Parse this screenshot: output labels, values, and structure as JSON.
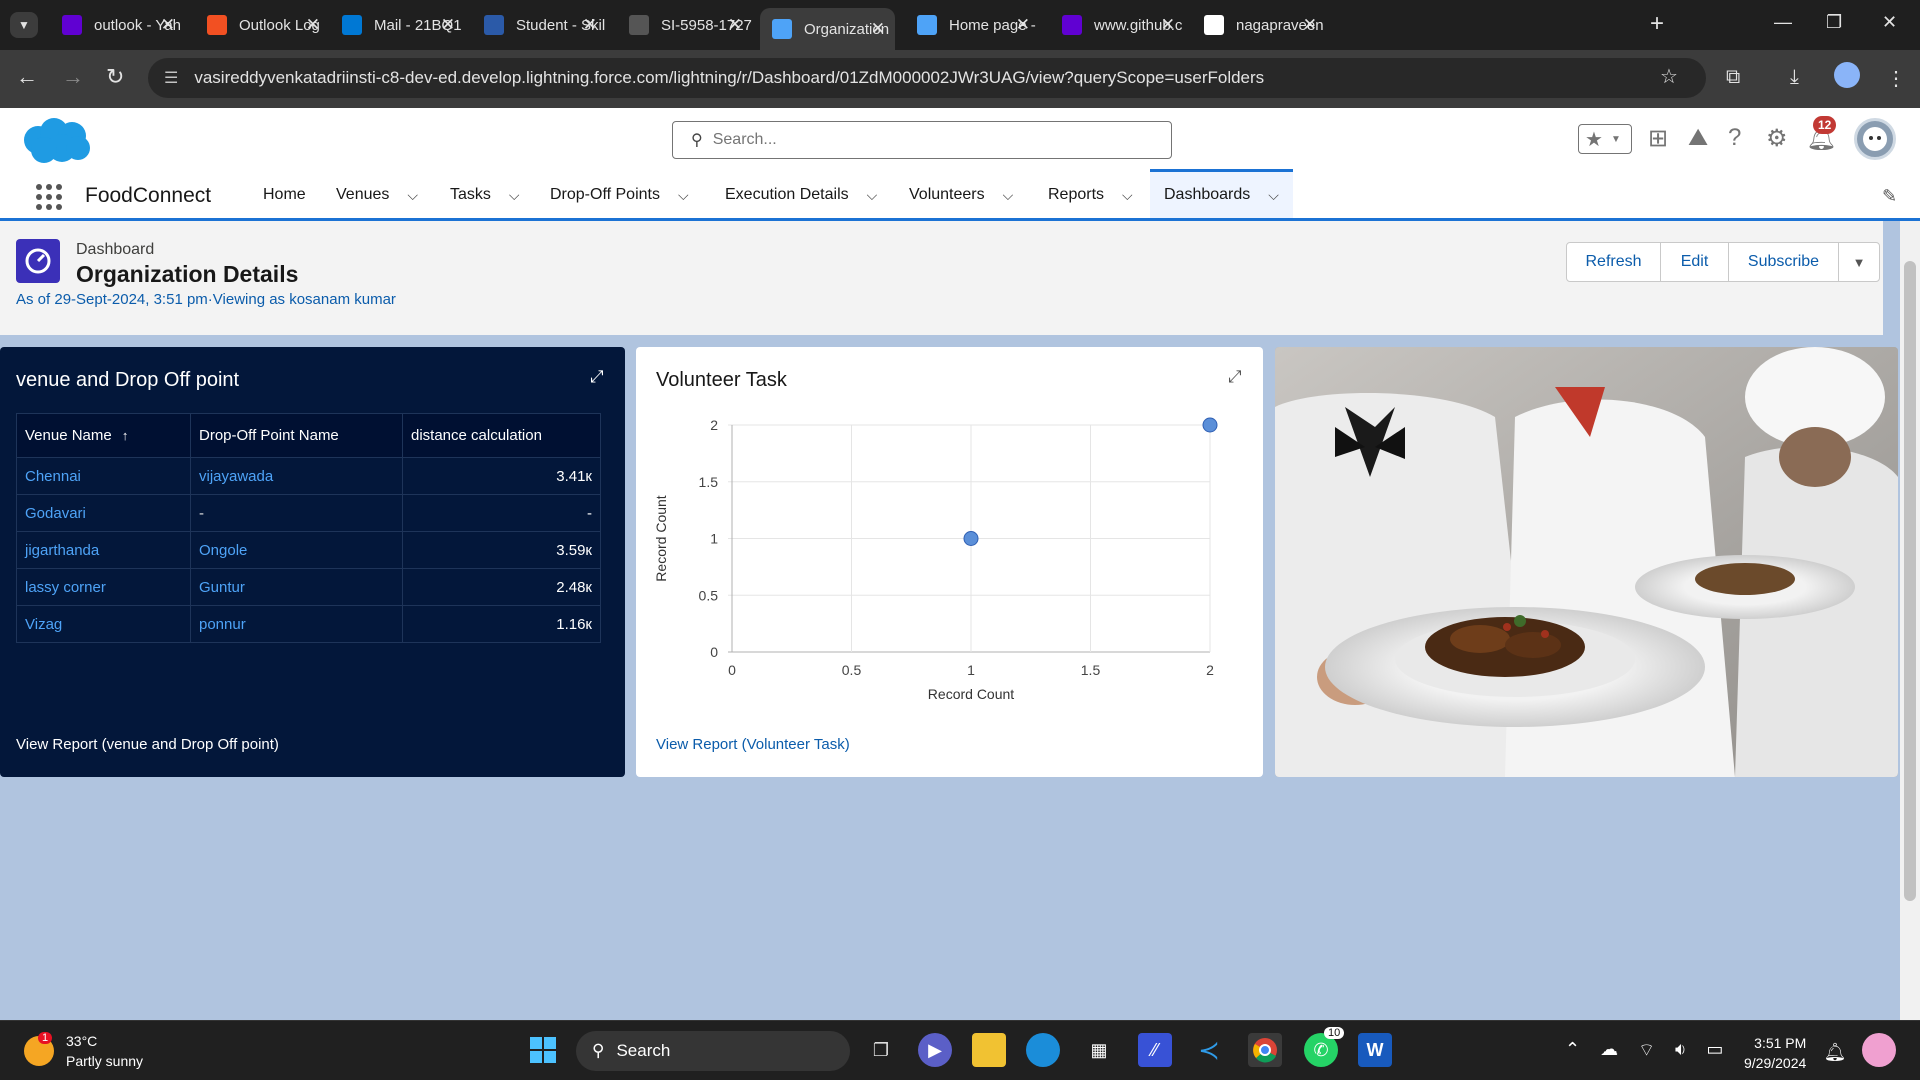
{
  "browser": {
    "tabs": [
      {
        "title": "outlook - Yah",
        "favicon": "yahoo-icon",
        "color": "#6001d2"
      },
      {
        "title": "Outlook Log",
        "favicon": "microsoft-icon",
        "color": "#f25022"
      },
      {
        "title": "Mail - 21BQ1",
        "favicon": "outlook-icon",
        "color": "#0078d4"
      },
      {
        "title": "Student - Skil",
        "favicon": "skill-icon",
        "color": "#2b5aa8"
      },
      {
        "title": "SI-5958-1727",
        "favicon": "document-icon",
        "color": "#555555"
      },
      {
        "title": "Organization",
        "favicon": "salesforce-icon",
        "color": "#4ea3f7"
      },
      {
        "title": "Home page -",
        "favicon": "salesforce-icon",
        "color": "#4ea3f7"
      },
      {
        "title": "www.github.c",
        "favicon": "yahoo-icon",
        "color": "#6001d2"
      },
      {
        "title": "nagapraveen",
        "favicon": "github-icon",
        "color": "#ffffff"
      }
    ],
    "active_tab_index": 5,
    "url": "vasireddyvenkatadriinsti-c8-dev-ed.develop.lightning.force.com/lightning/r/Dashboard/01ZdM000002JWr3UAG/view?queryScope=userFolders"
  },
  "sf": {
    "search_placeholder": "Search...",
    "notification_count": "12",
    "app_name": "FoodConnect",
    "nav": [
      {
        "label": "Home",
        "has_menu": false
      },
      {
        "label": "Venues",
        "has_menu": true
      },
      {
        "label": "Tasks",
        "has_menu": true
      },
      {
        "label": "Drop-Off Points",
        "has_menu": true
      },
      {
        "label": "Execution Details",
        "has_menu": true
      },
      {
        "label": "Volunteers",
        "has_menu": true
      },
      {
        "label": "Reports",
        "has_menu": true
      },
      {
        "label": "Dashboards",
        "has_menu": true,
        "active": true
      }
    ]
  },
  "dashboard": {
    "type_label": "Dashboard",
    "title": "Organization Details",
    "meta": "As of 29-Sept-2024, 3:51 pm·Viewing as kosanam kumar",
    "actions": [
      "Refresh",
      "Edit",
      "Subscribe"
    ]
  },
  "table_card": {
    "title": "venue and Drop Off point",
    "columns": [
      "Venue Name",
      "Drop-Off Point Name",
      "distance calculation"
    ],
    "sort_indicator": "↑",
    "rows": [
      [
        "Chennai",
        "vijayawada",
        "3.41к"
      ],
      [
        "Godavari",
        "-",
        "-"
      ],
      [
        "jigarthanda",
        "Ongole",
        "3.59к"
      ],
      [
        "lassy corner",
        "Guntur",
        "2.48к"
      ],
      [
        "Vizag",
        "ponnur",
        "1.16к"
      ]
    ],
    "view_report": "View Report (venue and Drop Off point)"
  },
  "chart_card": {
    "title": "Volunteer Task",
    "view_report": "View Report (Volunteer Task)"
  },
  "chart_data": {
    "type": "scatter",
    "title": "Volunteer Task",
    "xlabel": "Record Count",
    "ylabel": "Record Count",
    "xlim": [
      0,
      2
    ],
    "ylim": [
      0,
      2
    ],
    "x_ticks": [
      "0",
      "0.5",
      "1",
      "1.5",
      "2"
    ],
    "y_ticks": [
      "0",
      "0.5",
      "1",
      "1.5",
      "2"
    ],
    "grid": true,
    "points": [
      {
        "x": 1,
        "y": 1
      },
      {
        "x": 2,
        "y": 2
      }
    ],
    "point_color": "#5b8fd8"
  },
  "taskbar": {
    "weather_temp": "33°C",
    "weather_desc": "Partly sunny",
    "weather_badge": "1",
    "search_label": "Search",
    "whatsapp_badge": "10",
    "time": "3:51 PM",
    "date": "9/29/2024"
  }
}
